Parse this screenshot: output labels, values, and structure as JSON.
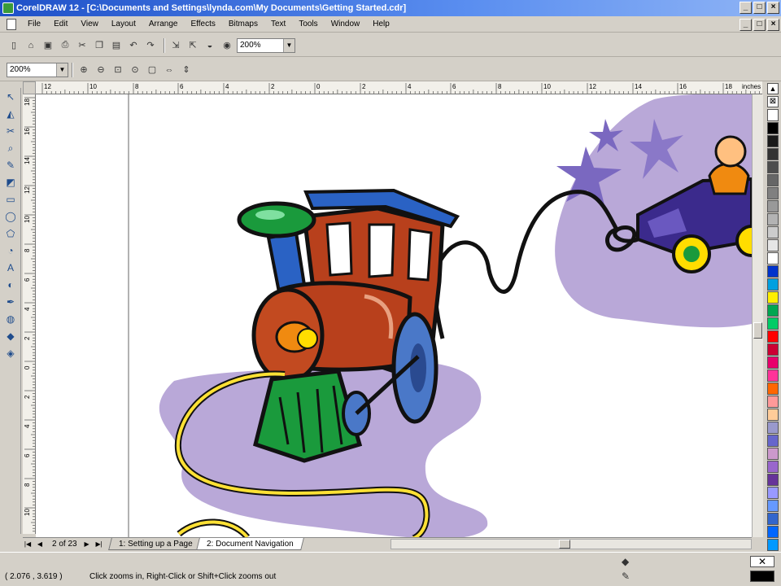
{
  "window": {
    "title": "CorelDRAW 12 - [C:\\Documents and Settings\\lynda.com\\My Documents\\Getting Started.cdr]",
    "buttons": [
      "_",
      "□",
      "×"
    ]
  },
  "menubar": {
    "items": [
      "File",
      "Edit",
      "View",
      "Layout",
      "Arrange",
      "Effects",
      "Bitmaps",
      "Text",
      "Tools",
      "Window",
      "Help"
    ]
  },
  "standard_toolbar": {
    "zoom_combo_value": "200%"
  },
  "zoom_toolbar": {
    "zoom_combo_value": "200%"
  },
  "rulers": {
    "unit": "inches",
    "h_ticks": [
      "12",
      "10",
      "8",
      "6",
      "4",
      "2",
      "0",
      "2",
      "4",
      "6",
      "8",
      "10",
      "12",
      "14",
      "16",
      "18"
    ],
    "v_ticks": [
      "18",
      "16",
      "14",
      "12",
      "10",
      "8",
      "6",
      "4",
      "2",
      "0",
      "2",
      "4",
      "6",
      "8",
      "10"
    ]
  },
  "page_nav": {
    "counter": "2 of 23",
    "tabs": [
      "1: Setting up a Page",
      "2: Document Navigation"
    ],
    "active_tab": 1
  },
  "statusbar": {
    "coordinates": "( 2.076 , 3.619 )",
    "hint": "Click zooms in, Right-Click or Shift+Click zooms out"
  },
  "palette": {
    "colors": [
      "#ffffff",
      "#000000",
      "#1a1a1a",
      "#333333",
      "#4d4d4d",
      "#666666",
      "#808080",
      "#999999",
      "#b3b3b3",
      "#cccccc",
      "#e6e6e6",
      "#ffffff",
      "#0033cc",
      "#00a0e0",
      "#ffee00",
      "#00a651",
      "#00cc66",
      "#ff0000",
      "#cc0033",
      "#e8006b",
      "#ff3399",
      "#ff6600",
      "#ff9999",
      "#ffcc99",
      "#9999cc",
      "#6666cc",
      "#cc99cc",
      "#9966cc",
      "#663399",
      "#9999ff",
      "#6699ff",
      "#3366cc",
      "#0066ff",
      "#0099ff"
    ]
  },
  "colors": {
    "title_bar": "#1e50c8",
    "background_blob": "#b9a8d8",
    "train_body": "#b8401c",
    "train_cab": "#2a62c4",
    "train_green": "#1a9a3c",
    "pull_string": "#ffe135"
  }
}
